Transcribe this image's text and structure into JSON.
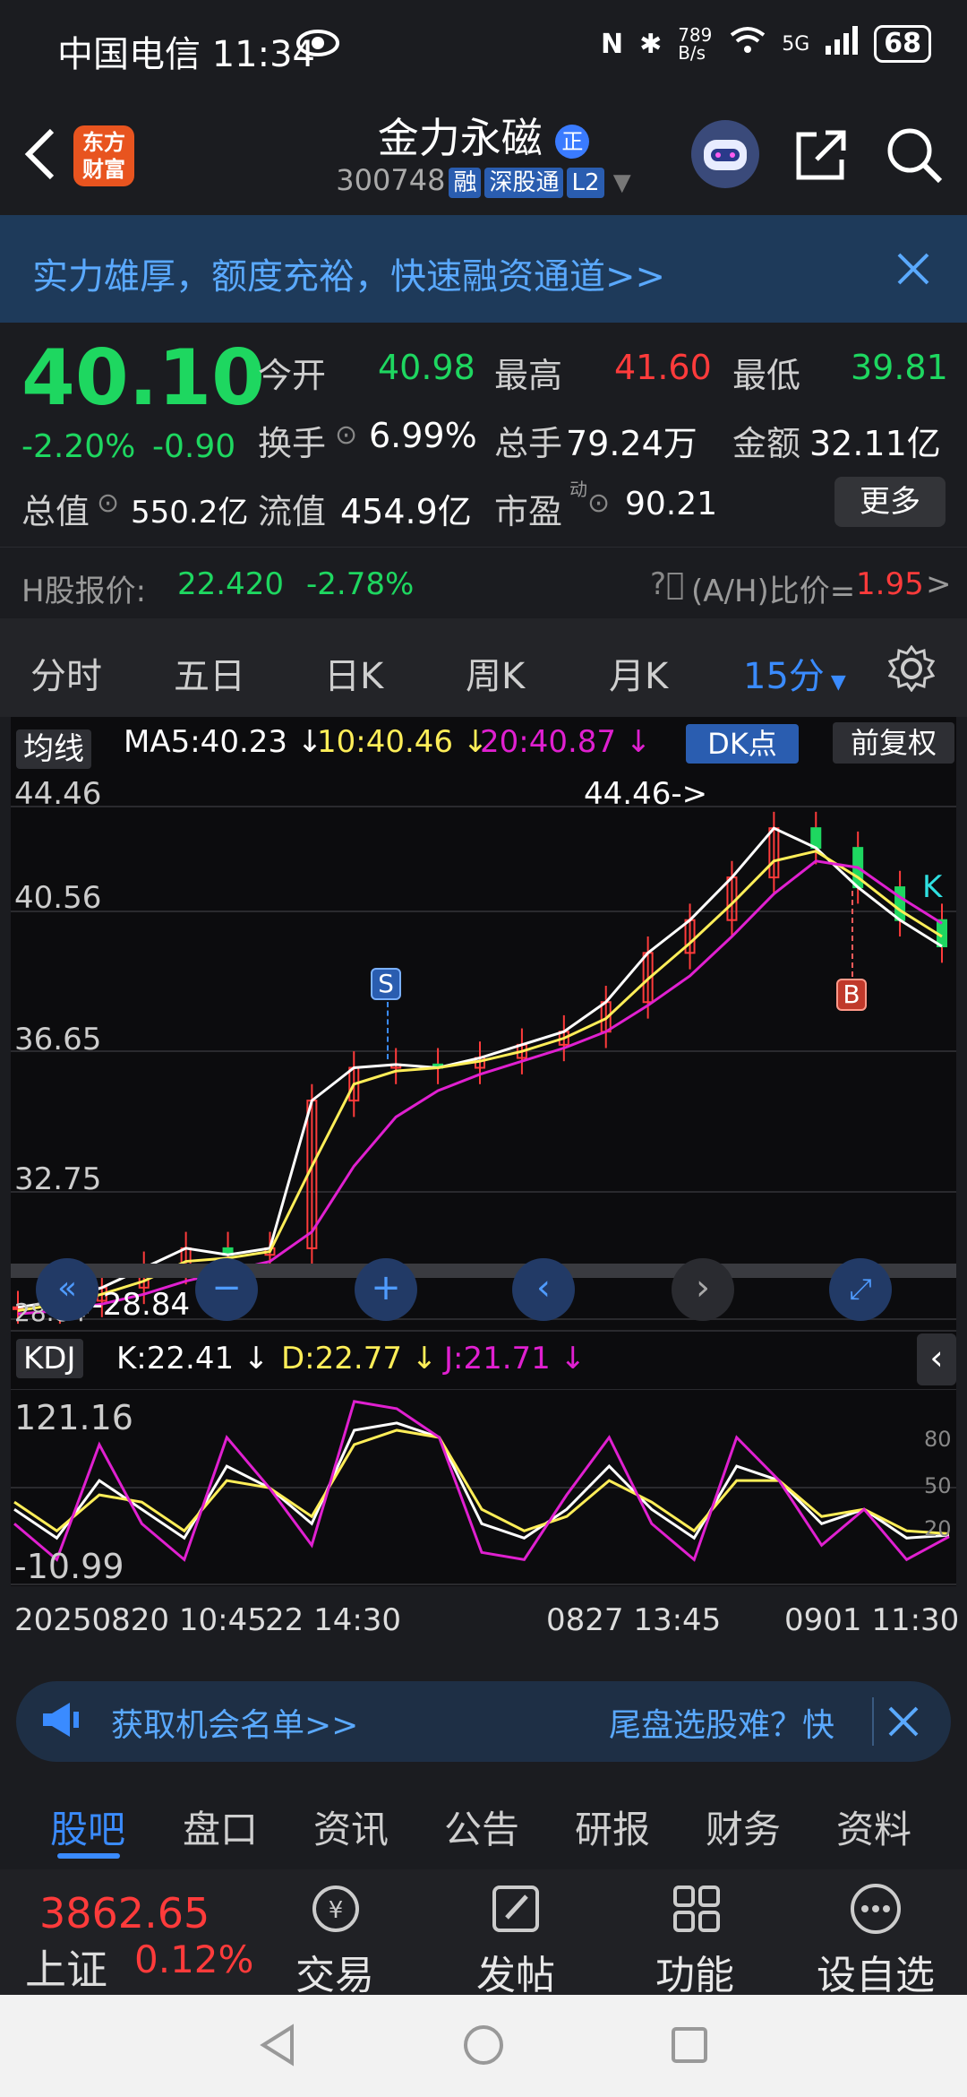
{
  "status": {
    "carrier_time": "中国电信 11:34",
    "net_speed": "789 B/s",
    "network": "5G",
    "battery": "68"
  },
  "header": {
    "title": "金力永磁",
    "title_badge": "正",
    "code": "300748",
    "tags": [
      "融",
      "深股通",
      "L2"
    ],
    "logo_text": "东方财富"
  },
  "banner": {
    "text": "实力雄厚，额度充裕，快速融资通道>>"
  },
  "quote": {
    "price": "40.10",
    "pct": "-2.20%",
    "chg": "-0.90",
    "open_label": "今开",
    "open": "40.98",
    "high_label": "最高",
    "high": "41.60",
    "low_label": "最低",
    "low": "39.81",
    "turnover_label": "换手",
    "turnover": "6.99%",
    "volume_label": "总手",
    "volume": "79.24万",
    "amount_label": "金额",
    "amount": "32.11亿",
    "mcap_label": "总值",
    "mcap": "550.2亿",
    "float_label": "流值",
    "float": "454.9亿",
    "pe_label": "市盈",
    "pe_sup": "动",
    "pe": "90.21",
    "more": "更多"
  },
  "hshare": {
    "label": "H股报价:",
    "price": "22.420",
    "pct": "-2.78%",
    "ratio_label": "(A/H)比价=",
    "ratio": "1.95",
    "arrow": ">"
  },
  "tabs": [
    "分时",
    "五日",
    "日K",
    "周K",
    "月K",
    "15分"
  ],
  "ma": {
    "label": "均线",
    "ma5": "MA5:40.23",
    "ma10": "10:40.46",
    "ma20": "20:40.87",
    "dk": "DK点",
    "fq": "前复权"
  },
  "main_axis": [
    "44.46",
    "40.56",
    "36.65",
    "32.75",
    "28.84"
  ],
  "annotations": {
    "high": "44.46->",
    "low": "<-28.84",
    "s": "S",
    "b": "B",
    "k": "K"
  },
  "kdj": {
    "label": "KDJ",
    "k": "K:22.41",
    "d": "D:22.77",
    "j": "J:21.71",
    "top": "121.16",
    "bottom": "-10.99",
    "r80": "80",
    "r50": "50",
    "r20": "20"
  },
  "time_axis": [
    "20250820 10:45",
    "22 14:30",
    "0827 13:45",
    "0901 11:30"
  ],
  "ad": {
    "left": "获取机会名单>>",
    "right": "尾盘选股难？快"
  },
  "subtabs": [
    "股吧",
    "盘口",
    "资讯",
    "公告",
    "研报",
    "财务",
    "资料"
  ],
  "bottom": {
    "index_value": "3862.65",
    "index_name": "上证",
    "index_pct": "0.12%",
    "trade": "交易",
    "post": "发帖",
    "func": "功能",
    "custom": "设自选"
  },
  "colors": {
    "up": "#ff3b3b",
    "down": "#1ed760",
    "ma5": "#ffffff",
    "ma10": "#ffee58",
    "ma20": "#e020d0",
    "accent": "#2a5db0"
  },
  "chart_data": [
    {
      "type": "line",
      "title": "",
      "yaxis_ticks": [
        44.46,
        40.56,
        36.65,
        32.75,
        28.84
      ],
      "ylim": [
        28.84,
        44.46
      ],
      "series": [
        {
          "name": "MA5",
          "values": [
            29.2,
            29.4,
            29.8,
            30.4,
            31.0,
            30.8,
            31.0,
            35.5,
            36.5,
            36.6,
            36.5,
            36.8,
            37.2,
            37.6,
            38.5,
            40.0,
            41.0,
            42.3,
            43.8,
            43.2,
            42.0,
            41.0,
            40.2
          ]
        },
        {
          "name": "10",
          "values": [
            29.1,
            29.3,
            29.6,
            30.0,
            30.6,
            30.7,
            30.9,
            33.5,
            36.0,
            36.4,
            36.5,
            36.7,
            37.0,
            37.4,
            38.0,
            39.2,
            40.3,
            41.5,
            42.8,
            43.1,
            42.3,
            41.3,
            40.5
          ]
        },
        {
          "name": "20",
          "values": [
            29.0,
            29.1,
            29.3,
            29.6,
            30.0,
            30.3,
            30.6,
            31.5,
            33.5,
            35.0,
            35.8,
            36.3,
            36.7,
            37.1,
            37.6,
            38.4,
            39.3,
            40.5,
            41.8,
            42.8,
            42.6,
            41.7,
            40.9
          ]
        }
      ]
    },
    {
      "type": "line",
      "title": "",
      "ylim": [
        -10.99,
        121.16
      ],
      "series": [
        {
          "name": "K",
          "values": [
            40,
            20,
            60,
            40,
            20,
            70,
            55,
            30,
            95,
            100,
            90,
            30,
            20,
            40,
            70,
            40,
            20,
            70,
            60,
            30,
            40,
            20,
            22
          ]
        },
        {
          "name": "D",
          "values": [
            45,
            25,
            50,
            45,
            25,
            60,
            55,
            35,
            85,
            95,
            90,
            40,
            25,
            35,
            60,
            45,
            25,
            60,
            60,
            35,
            40,
            25,
            23
          ]
        },
        {
          "name": "J",
          "values": [
            30,
            5,
            85,
            30,
            5,
            90,
            55,
            15,
            115,
            110,
            90,
            10,
            5,
            50,
            90,
            30,
            5,
            90,
            60,
            15,
            40,
            5,
            21
          ]
        }
      ]
    }
  ]
}
